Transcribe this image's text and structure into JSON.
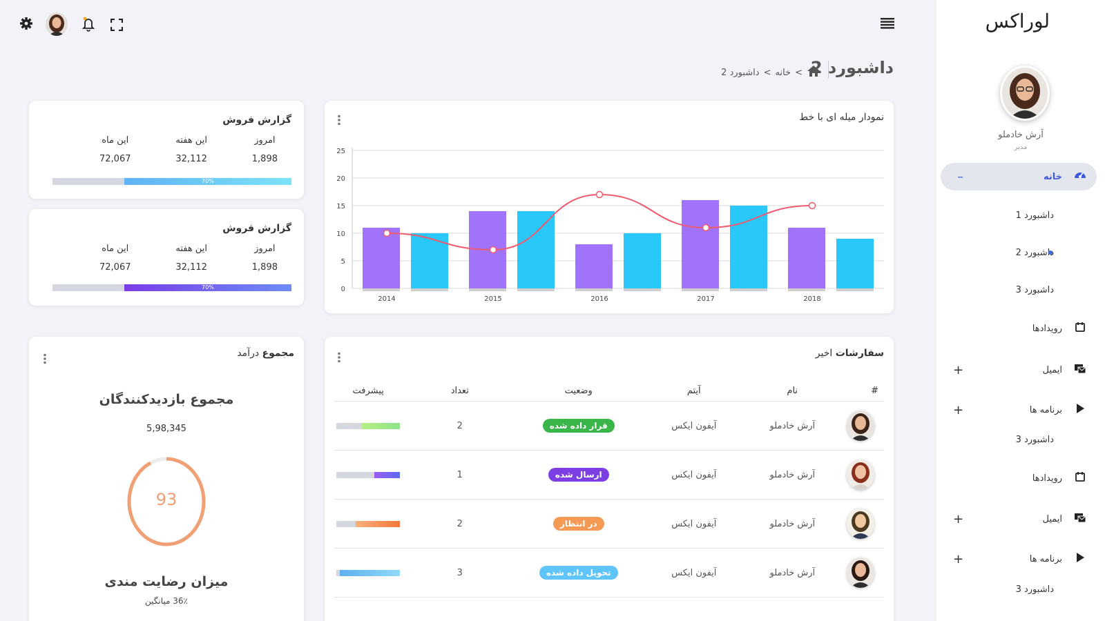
{
  "sidebar": {
    "logo": "لوراکس",
    "profile_name": "آرش خادملو",
    "profile_role": "مدیر",
    "items": [
      {
        "label": "خانه",
        "icon": "dashboard-icon",
        "toggle": "–"
      },
      {
        "label": "داشبورد 1"
      },
      {
        "label": "داشبورد 2"
      },
      {
        "label": "داشبورد 3"
      },
      {
        "label": "رویدادها",
        "icon": "calendar-icon"
      },
      {
        "label": "ایمیل",
        "icon": "email-icon",
        "toggle": "+"
      },
      {
        "label": "برنامه ها",
        "icon": "apps-icon",
        "toggle": "+"
      },
      {
        "label": "داشبورد 3"
      },
      {
        "label": "رویدادها",
        "icon": "calendar-icon"
      },
      {
        "label": "ایمیل",
        "icon": "email-icon",
        "toggle": "+"
      },
      {
        "label": "برنامه ها",
        "icon": "apps-icon",
        "toggle": "+"
      },
      {
        "label": "داشبورد 3"
      }
    ]
  },
  "page": {
    "title": "داشبورد 2",
    "breadcrumb": [
      "خانه",
      "داشبورد 2"
    ],
    "breadcrumb_sep": ">"
  },
  "sales_cards": [
    {
      "title": "گزارش فروش",
      "labels": [
        "امروز",
        "این هفته",
        "این ماه"
      ],
      "values": [
        "1,898",
        "32,112",
        "72,067"
      ],
      "progress_label": "70%",
      "progress": 0.7
    },
    {
      "title": "گزارش فروش",
      "labels": [
        "امروز",
        "این هفته",
        "این ماه"
      ],
      "values": [
        "1,898",
        "32,112",
        "72,067"
      ],
      "progress_label": "70%",
      "progress": 0.7
    }
  ],
  "chart_card": {
    "title": "نمودار میله ای با خط"
  },
  "chart_data": {
    "type": "bar",
    "categories": [
      "2014",
      "2015",
      "2016",
      "2017",
      "2018"
    ],
    "series": [
      {
        "values": [
          11,
          14,
          8,
          16,
          11
        ],
        "color": "#a173fb"
      },
      {
        "values": [
          10,
          14,
          10,
          15,
          9
        ],
        "color": "#29c8f8"
      },
      {
        "values": [
          10,
          7,
          17,
          11,
          15
        ],
        "color": "#f05a6e",
        "kind": "line"
      }
    ],
    "yticks": [
      "0",
      "5",
      "10",
      "15",
      "20",
      "25"
    ],
    "ylim": [
      0,
      25
    ],
    "grid": true
  },
  "orders": {
    "title_bold": "سفارشات",
    "title_rest": "اخیر",
    "headers": [
      "#",
      "نام",
      "آیتم",
      "وضعیت",
      "تعداد",
      "پیشرفت"
    ],
    "rows": [
      {
        "name": "آرش خادملو",
        "item": "آیفون ایکس",
        "status": "قرار داده شده",
        "status_color": "#3ab54a",
        "count": "2",
        "progress": 0.6,
        "progress_color": "linear-gradient(to left,#8fe388,#b7ef86)"
      },
      {
        "name": "آرش خادملو",
        "item": "آیفون ایکس",
        "status": "ارسال شده",
        "status_color": "#7b3fe4",
        "count": "1",
        "progress": 0.4,
        "progress_color": "linear-gradient(to left,#5b6cf0,#9b5cf0)"
      },
      {
        "name": "آرش خادملو",
        "item": "آیفون ایکس",
        "status": "در انتظار",
        "status_color": "#f59a54",
        "count": "2",
        "progress": 0.7,
        "progress_color": "linear-gradient(to left,#f5763b,#f7b27a)"
      },
      {
        "name": "آرش خادملو",
        "item": "آیفون ایکس",
        "status": "تحویل داده شده",
        "status_color": "#5fc4f7",
        "count": "3",
        "progress": 0.95,
        "progress_color": "linear-gradient(to left,#8edaf8,#5fb0f0)"
      }
    ]
  },
  "revenue": {
    "title_bold": "مجموع",
    "title_rest": "درآمد",
    "visitors_label": "مجموع بازدیدکنندگان",
    "visitors_value": "5,98,345",
    "gauge_value": "93",
    "gauge_fraction": 0.93,
    "gauge_color": "#f0a074",
    "satisfaction_label": "میزان رضایت مندی",
    "average_label": "36٪ میانگین"
  }
}
